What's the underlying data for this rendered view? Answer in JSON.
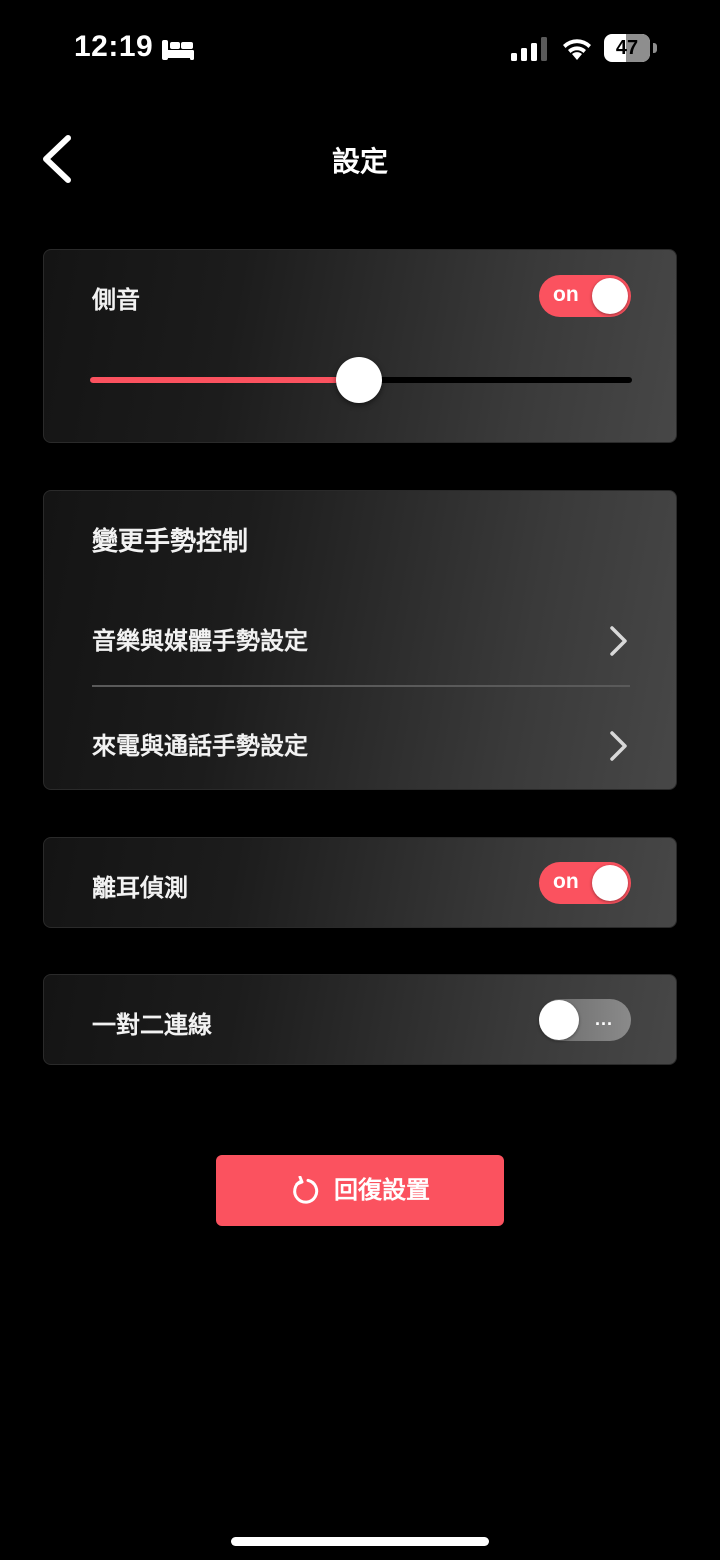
{
  "status_bar": {
    "time": "12:19",
    "battery_percent": "47",
    "battery_level": 0.47,
    "icons": [
      "sleep-icon",
      "signal-icon",
      "wifi-icon",
      "battery-icon"
    ]
  },
  "header": {
    "title": "設定",
    "back_icon": "chevron-left-icon"
  },
  "side_tone": {
    "label": "側音",
    "toggle_text": "on",
    "toggle_state": true,
    "slider_level": 0.5
  },
  "gesture_control": {
    "title": "變更手勢控制",
    "items": [
      {
        "label": "音樂與媒體手勢設定",
        "icon": "chevron-right-icon"
      },
      {
        "label": "來電與通話手勢設定",
        "icon": "chevron-right-icon"
      }
    ]
  },
  "ear_detection": {
    "label": "離耳偵測",
    "toggle_text": "on",
    "toggle_state": true
  },
  "multipoint": {
    "label": "一對二連線",
    "toggle_text": "...",
    "toggle_state": false
  },
  "reset": {
    "label": "回復設置",
    "icon": "reset-icon"
  },
  "colors": {
    "accent": "#fb525f",
    "background": "#000000",
    "text": "#ffffff"
  }
}
